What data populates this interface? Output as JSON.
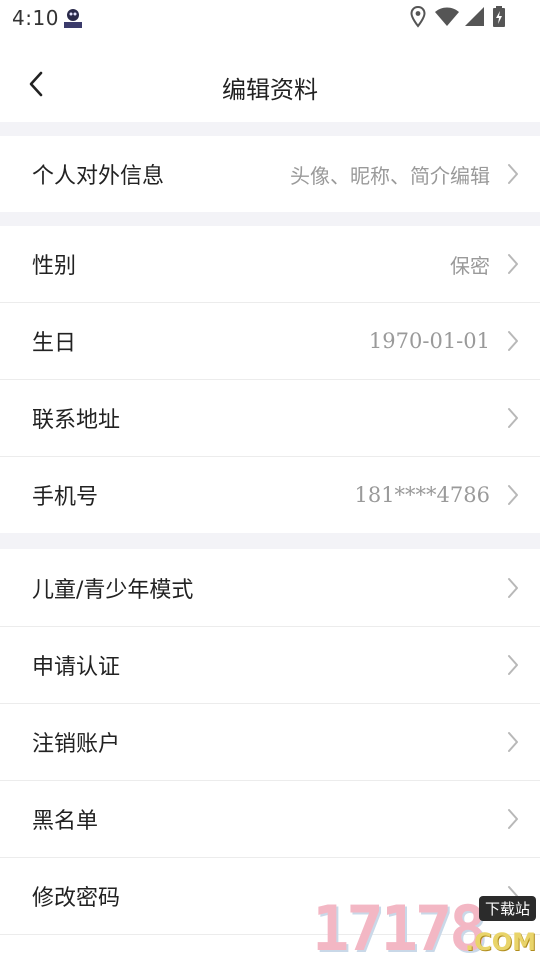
{
  "status_bar": {
    "time": "4:10",
    "icons": [
      "app-notification-icon",
      "location-icon",
      "wifi-icon",
      "signal-icon",
      "battery-charging-icon"
    ]
  },
  "header": {
    "title": "编辑资料",
    "back_icon": "chevron-left-icon"
  },
  "sections": [
    {
      "items": [
        {
          "key": "profile-info",
          "label": "个人对外信息",
          "value": "头像、昵称、简介编辑"
        }
      ]
    },
    {
      "items": [
        {
          "key": "gender",
          "label": "性别",
          "value": "保密"
        },
        {
          "key": "birthday",
          "label": "生日",
          "value": "1970-01-01"
        },
        {
          "key": "address",
          "label": "联系地址",
          "value": ""
        },
        {
          "key": "phone",
          "label": "手机号",
          "value": "181****4786"
        }
      ]
    },
    {
      "items": [
        {
          "key": "youth-mode",
          "label": "儿童/青少年模式",
          "value": ""
        },
        {
          "key": "apply-verification",
          "label": "申请认证",
          "value": ""
        },
        {
          "key": "cancel-account",
          "label": "注销账户",
          "value": ""
        },
        {
          "key": "blacklist",
          "label": "黑名单",
          "value": ""
        },
        {
          "key": "change-password",
          "label": "修改密码",
          "value": ""
        }
      ]
    }
  ],
  "watermark": {
    "digits": "17178",
    "domain": ".COM",
    "badge": "下载站"
  },
  "colors": {
    "section_gap": "#f3f3f7",
    "label": "#222222",
    "value": "#9a9a9a",
    "chevron": "#b8b8b8"
  }
}
